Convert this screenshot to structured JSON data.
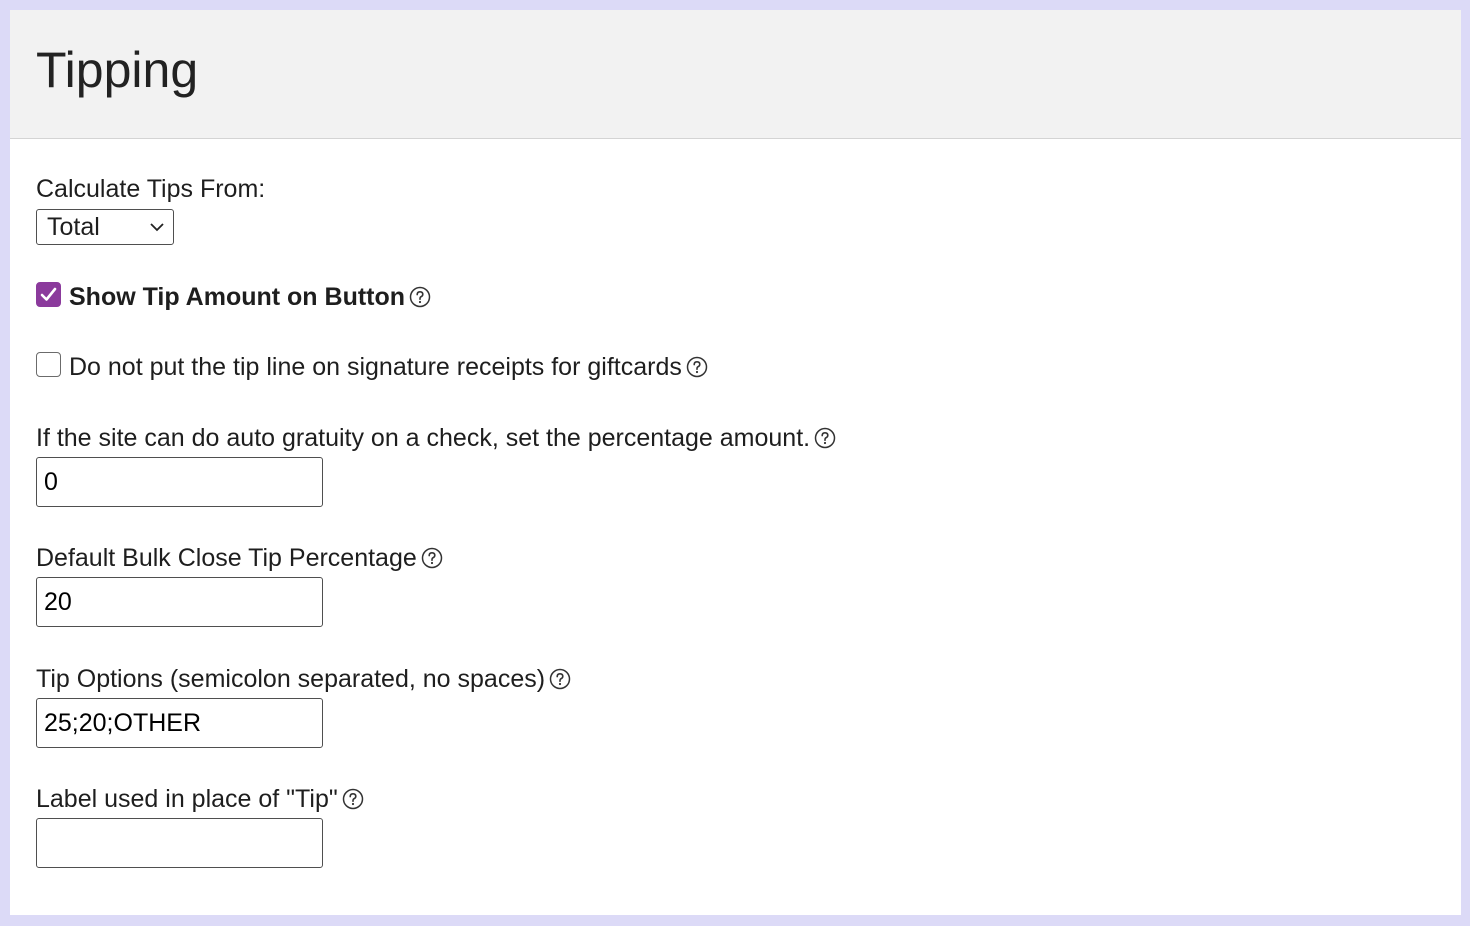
{
  "panel": {
    "title": "Tipping"
  },
  "calculate_from": {
    "label": "Calculate Tips From:",
    "selected": "Total"
  },
  "show_tip_amount": {
    "label": "Show Tip Amount on Button",
    "checked": true
  },
  "no_tip_line_giftcards": {
    "label": "Do not put the tip line on signature receipts for giftcards",
    "checked": false
  },
  "auto_gratuity": {
    "label": "If the site can do auto gratuity on a check, set the percentage amount.",
    "value": "0"
  },
  "bulk_close_tip": {
    "label": "Default Bulk Close Tip Percentage",
    "value": "20"
  },
  "tip_options": {
    "label": "Tip Options (semicolon separated, no spaces)",
    "value": "25;20;OTHER"
  },
  "tip_label": {
    "label": "Label used in place of \"Tip\"",
    "value": ""
  },
  "icons": {
    "help": "question-circle-icon",
    "chevron": "chevron-down-icon",
    "check": "checkmark-icon"
  },
  "colors": {
    "page_background": "#dcdaf7",
    "header_background": "#f2f2f2",
    "checkbox_accent": "#8b3a9c"
  }
}
